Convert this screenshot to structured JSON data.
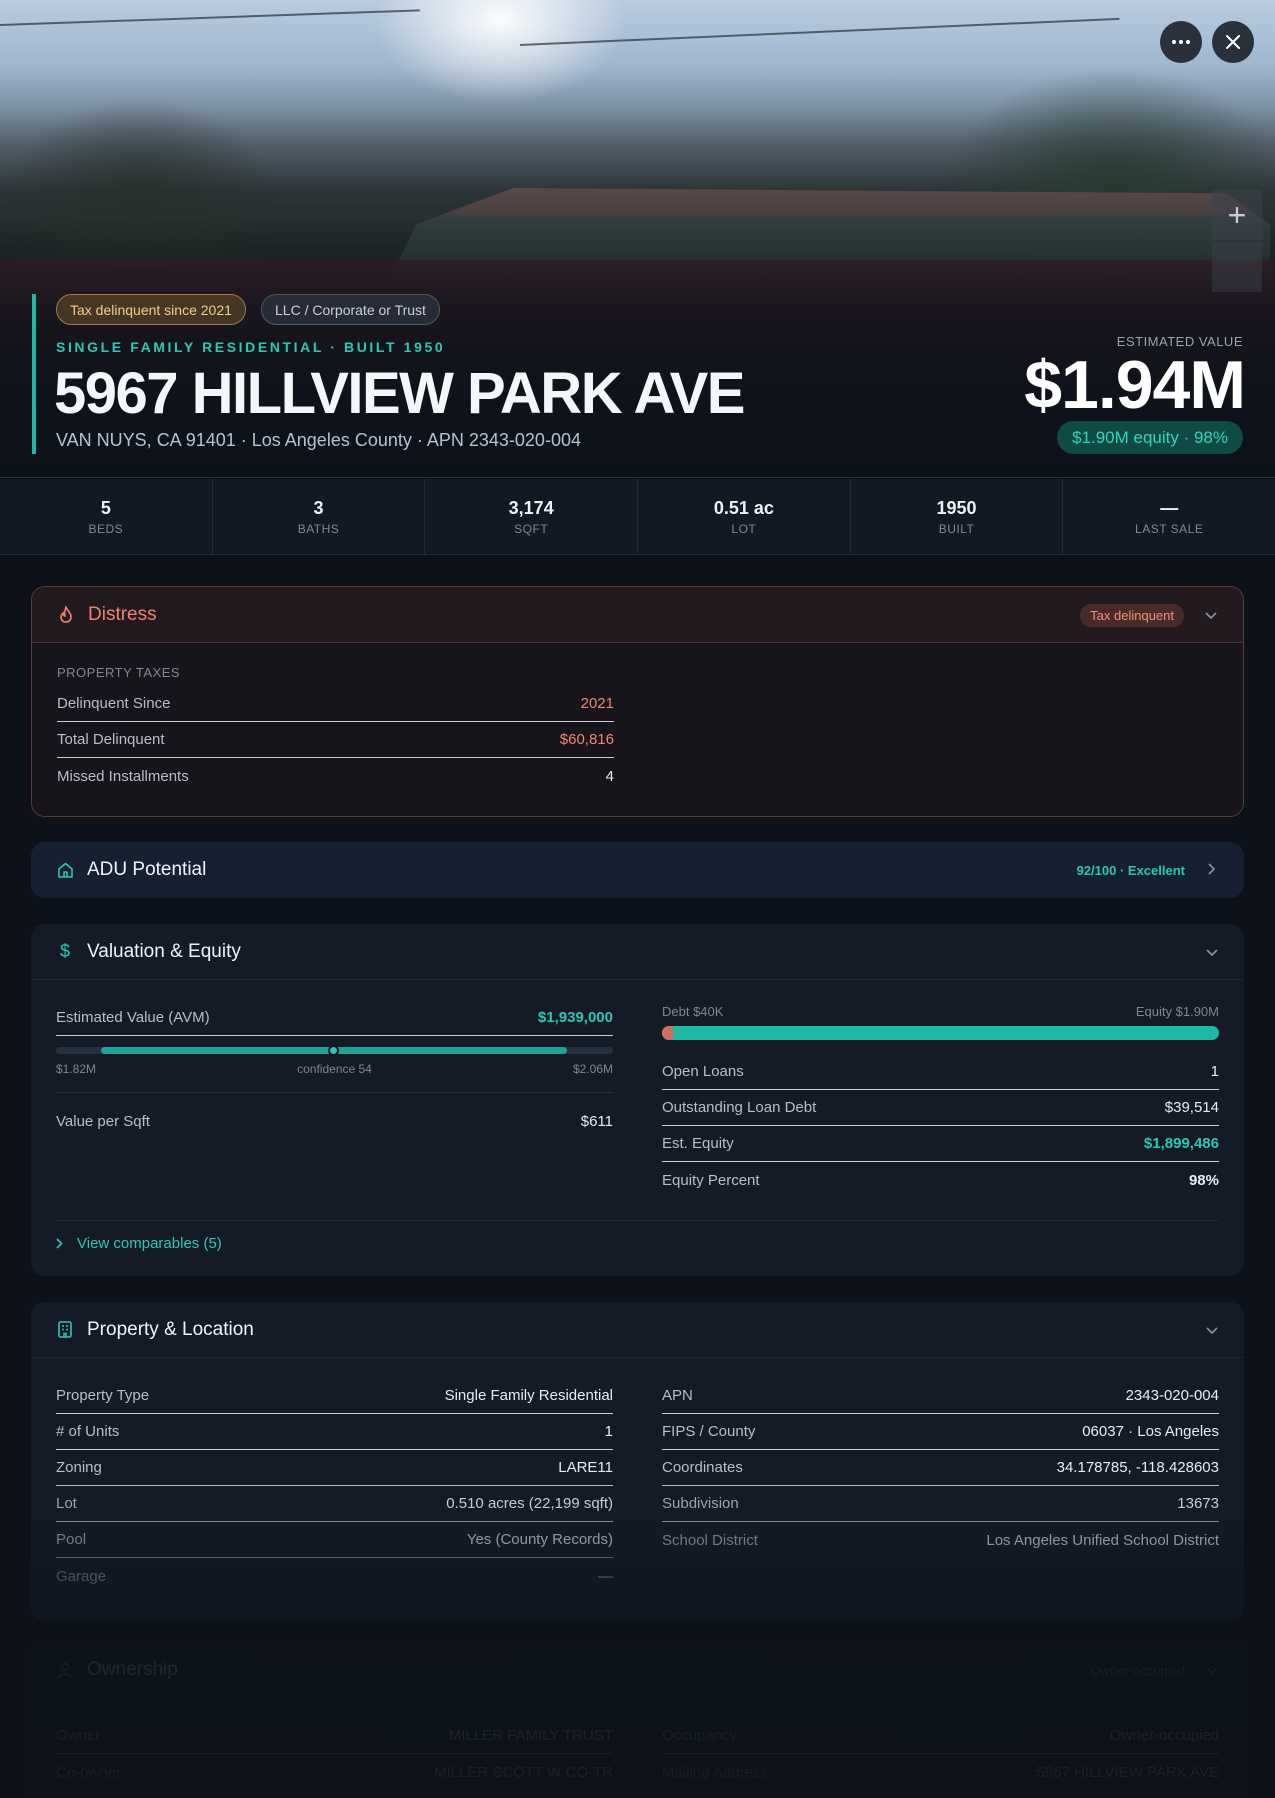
{
  "hero": {
    "badges": [
      "Tax delinquent since 2021",
      "LLC / Corporate or Trust"
    ],
    "subtitle": "SINGLE FAMILY RESIDENTIAL · BUILT 1950",
    "title": "5967 HILLVIEW PARK AVE",
    "address_line": "VAN NUYS, CA 91401 · Los Angeles County · APN 2343-020-004",
    "estimated_label": "ESTIMATED VALUE",
    "estimated_value": "$1.94M",
    "equity_pill": "$1.90M equity · 98%",
    "more_icon": "more-horizontal-icon",
    "close_icon": "close-icon",
    "zoom_in_label": "+"
  },
  "stats": [
    {
      "value": "5",
      "label": "BEDS"
    },
    {
      "value": "3",
      "label": "BATHS"
    },
    {
      "value": "3,174",
      "label": "SQFT"
    },
    {
      "value": "0.51 ac",
      "label": "LOT"
    },
    {
      "value": "1950",
      "label": "BUILT"
    },
    {
      "value": "—",
      "label": "LAST SALE"
    }
  ],
  "distress": {
    "title": "Distress",
    "icon": "flame-icon",
    "badge": "Tax delinquent",
    "section": "PROPERTY TAXES",
    "rows": [
      {
        "label": "Delinquent Since",
        "value": "2021"
      },
      {
        "label": "Total Delinquent",
        "value": "$60,816"
      },
      {
        "label": "Missed Installments",
        "value": "4"
      }
    ]
  },
  "adu": {
    "title": "ADU Potential",
    "icon": "home-icon",
    "score": "92/100 · Excellent"
  },
  "valuation": {
    "title": "Valuation & Equity",
    "icon": "dollar-icon",
    "avm_label": "Estimated Value (AVM)",
    "avm_value": "$1,939,000",
    "range_low": "$1.82M",
    "range_high": "$2.06M",
    "confidence": "confidence 54",
    "value_per_sqft_label": "Value per Sqft",
    "value_per_sqft": "$611",
    "debt_label": "Debt $40K",
    "equity_label": "Equity $1.90M",
    "debt_fraction": 0.02,
    "rows": [
      {
        "label": "Open Loans",
        "value": "1"
      },
      {
        "label": "Outstanding Loan Debt",
        "value": "$39,514"
      },
      {
        "label": "Est. Equity",
        "value": "$1,899,486"
      },
      {
        "label": "Equity Percent",
        "value": "98%"
      }
    ],
    "view_comparables": "View comparables (5)"
  },
  "property": {
    "title": "Property & Location",
    "icon": "building-icon",
    "left": [
      {
        "label": "Property Type",
        "value": "Single Family Residential"
      },
      {
        "label": "# of Units",
        "value": "1"
      },
      {
        "label": "Zoning",
        "value": "LARE11"
      },
      {
        "label": "Lot",
        "value": "0.510 acres (22,199 sqft)"
      },
      {
        "label": "Pool",
        "value": "Yes (County Records)"
      },
      {
        "label": "Garage",
        "value": "—"
      }
    ],
    "right": [
      {
        "label": "APN",
        "value": "2343-020-004"
      },
      {
        "label": "FIPS / County",
        "value": "06037 · Los Angeles"
      },
      {
        "label": "Coordinates",
        "value": "34.178785, -118.428603"
      },
      {
        "label": "Subdivision",
        "value": "13673"
      },
      {
        "label": "School District",
        "value": "Los Angeles Unified School District"
      }
    ]
  },
  "ownership": {
    "title": "Ownership",
    "icon": "user-icon",
    "badge": "Owner-occupied",
    "left": [
      {
        "label": "Owner",
        "value": "MILLER FAMILY TRUST"
      },
      {
        "label": "Co-owner",
        "value": "MILLER SCOTT W CO-TR"
      }
    ],
    "right": [
      {
        "label": "Occupancy",
        "value": "Owner-occupied"
      },
      {
        "label": "Mailing Address",
        "value": "5967 HILLVIEW PARK AVE"
      }
    ]
  },
  "colors": {
    "accent": "#2fc7b3",
    "distress": "#f0806b",
    "background": "#0d121a"
  }
}
